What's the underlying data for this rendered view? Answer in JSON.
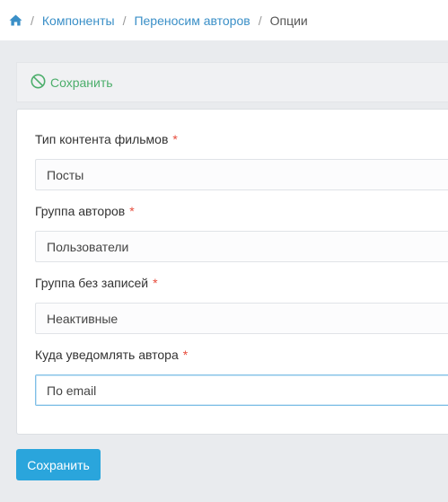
{
  "breadcrumb": {
    "home_icon": "home-icon",
    "items": [
      "Компоненты",
      "Переносим авторов"
    ],
    "separator": "/",
    "current": "Опции"
  },
  "toolbar": {
    "save_label": "Сохранить",
    "save_icon": "ban-icon"
  },
  "form": {
    "fields": [
      {
        "label": "Тип контента фильмов",
        "required_mark": "*",
        "value": "Посты"
      },
      {
        "label": "Группа авторов",
        "required_mark": "*",
        "value": "Пользователи"
      },
      {
        "label": "Группа без записей",
        "required_mark": "*",
        "value": "Неактивные"
      },
      {
        "label": "Куда уведомлять автора",
        "required_mark": "*",
        "value": "По email"
      }
    ],
    "submit_label": "Сохранить"
  },
  "colors": {
    "accent": "#2aa5dc",
    "link": "#3a8fc7",
    "toolbar_save": "#4cae6b",
    "required": "#e74c3c",
    "background": "#e9ebee"
  }
}
